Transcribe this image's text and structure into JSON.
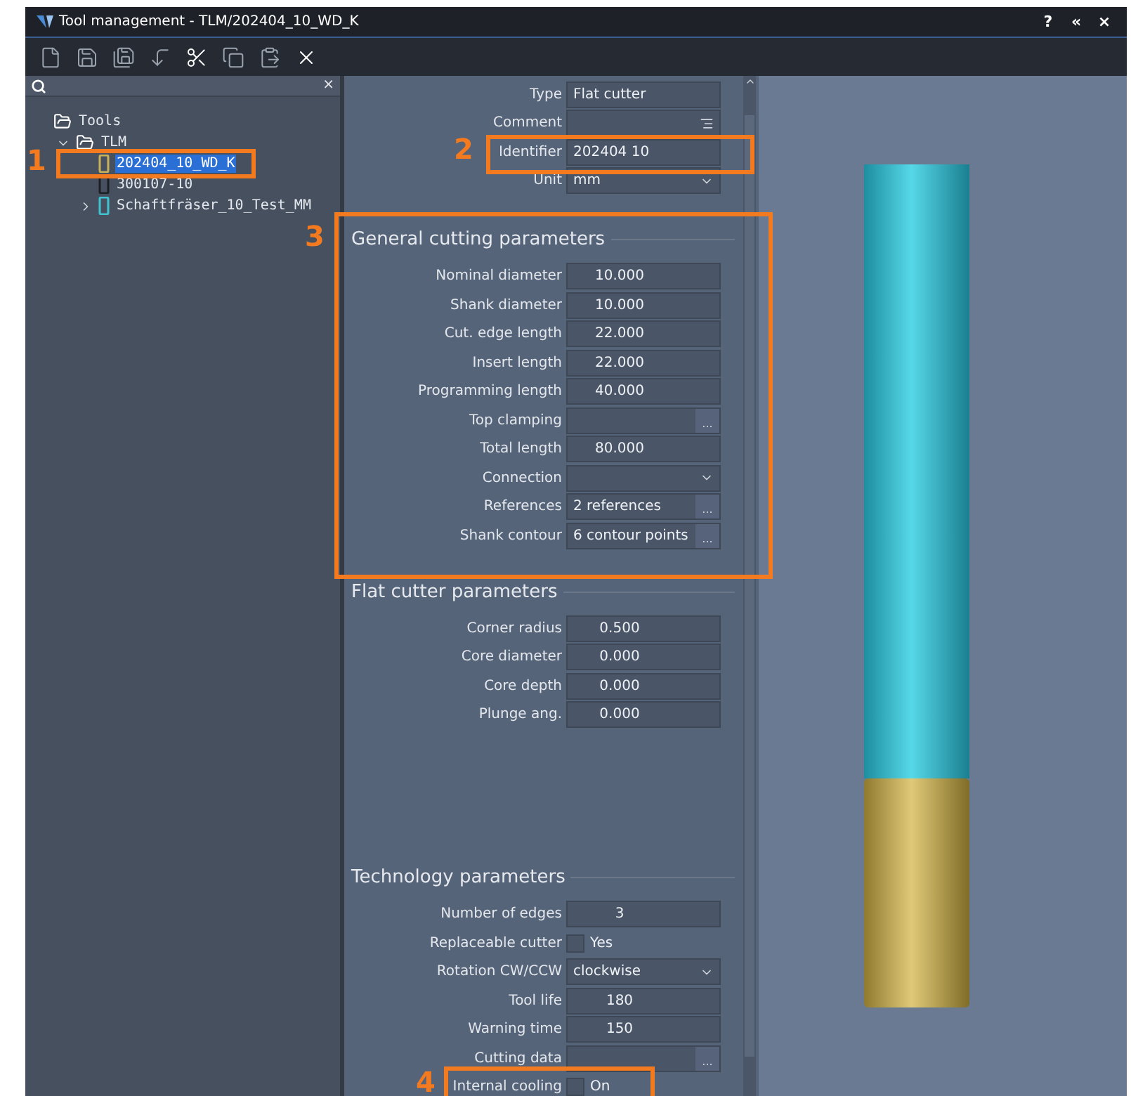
{
  "window": {
    "title": "Tool management - TLM/202404_10_WD_K",
    "controls": [
      "?",
      "«",
      "×"
    ]
  },
  "tree": {
    "search_close": "×",
    "items": [
      {
        "label": "Tools",
        "kind": "folder",
        "selected": false,
        "children": [
          {
            "label": "TLM",
            "kind": "folder",
            "expanded": true,
            "selected": false,
            "children": [
              {
                "label": "202404_10_WD_K",
                "kind": "tool",
                "color": "#c9b15a",
                "selected": true
              },
              {
                "label": "300107-10",
                "kind": "tool",
                "color": "#1d2024",
                "selected": false
              },
              {
                "label": "Schaftfräser_10_Test_MM",
                "kind": "tool",
                "color": "#3fc3d3",
                "selected": false,
                "expanded": false
              }
            ]
          }
        ]
      }
    ]
  },
  "form": {
    "top": [
      {
        "label": "Type",
        "kind": "text",
        "value": "Flat cutter"
      },
      {
        "label": "Comment",
        "kind": "comment"
      },
      {
        "label": "Identifier",
        "kind": "text",
        "value": "202404 10"
      },
      {
        "label": "Unit",
        "kind": "dropdown",
        "value": "mm"
      }
    ],
    "sections": [
      {
        "title": "General cutting parameters",
        "rows": [
          {
            "label": "Nominal diameter",
            "kind": "number",
            "value": "10.000"
          },
          {
            "label": "Shank diameter",
            "kind": "number",
            "value": "10.000"
          },
          {
            "label": "Cut. edge length",
            "kind": "number",
            "value": "22.000"
          },
          {
            "label": "Insert length",
            "kind": "number",
            "value": "22.000"
          },
          {
            "label": "Programming length",
            "kind": "number",
            "value": "40.000"
          },
          {
            "label": "Top clamping",
            "kind": "dots"
          },
          {
            "label": "Total length",
            "kind": "number",
            "value": "80.000"
          },
          {
            "label": "Connection",
            "kind": "dropdown"
          },
          {
            "label": "References",
            "kind": "dots",
            "value": "2 references"
          },
          {
            "label": "Shank contour",
            "kind": "dots",
            "value": "6 contour points"
          }
        ]
      },
      {
        "title": "Flat cutter parameters",
        "rows": [
          {
            "label": "Corner radius",
            "kind": "number",
            "value": "0.500"
          },
          {
            "label": "Core diameter",
            "kind": "number",
            "value": "0.000"
          },
          {
            "label": "Core depth",
            "kind": "number",
            "value": "0.000"
          },
          {
            "label": "Plunge ang.",
            "kind": "number",
            "value": "0.000"
          }
        ]
      },
      {
        "title": "Technology parameters",
        "rows": [
          {
            "label": "Number of edges",
            "kind": "number",
            "value": "3"
          },
          {
            "label": "Replaceable cutter",
            "kind": "checkbox",
            "value": "Yes",
            "checked": false
          },
          {
            "label": "Rotation CW/CCW",
            "kind": "dropdown",
            "value": "clockwise"
          },
          {
            "label": "Tool life",
            "kind": "number",
            "value": "180"
          },
          {
            "label": "Warning time",
            "kind": "number",
            "value": "150"
          },
          {
            "label": "Cutting data",
            "kind": "dots"
          },
          {
            "label": "Internal cooling",
            "kind": "checkbox",
            "value": "On",
            "checked": false
          }
        ]
      }
    ]
  },
  "dots_label": "...",
  "annotations": [
    {
      "number": "1"
    },
    {
      "number": "2"
    },
    {
      "number": "3"
    },
    {
      "number": "4"
    }
  ]
}
